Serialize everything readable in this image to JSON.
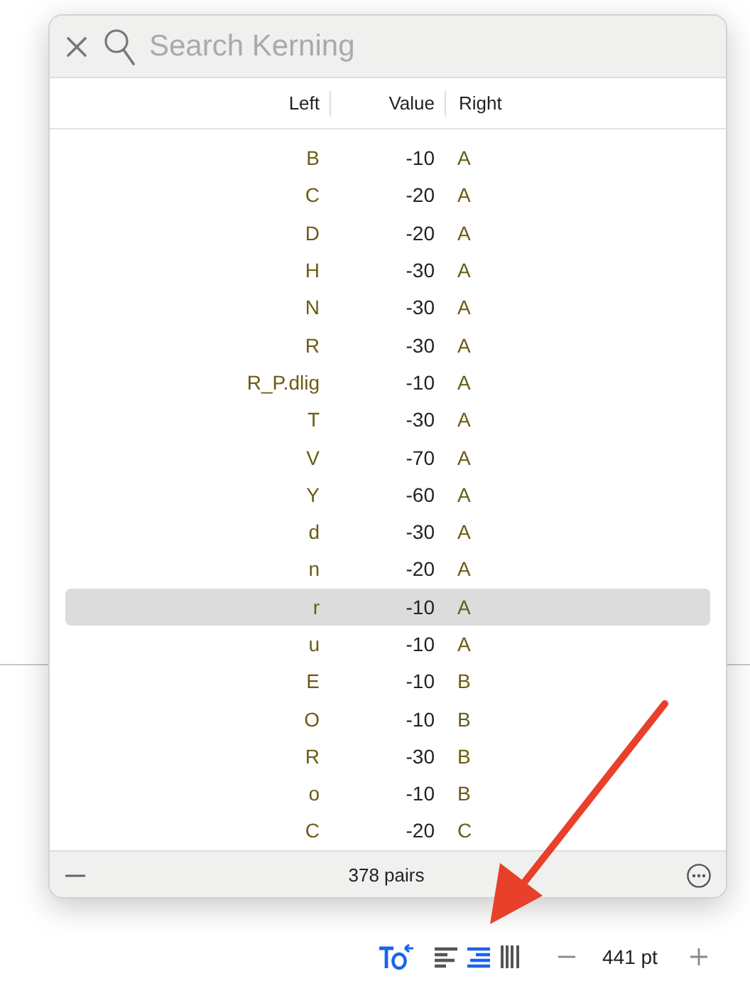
{
  "kerning_popover": {
    "search": {
      "placeholder": "Search Kerning"
    },
    "columns": [
      "Left",
      "Value",
      "Right"
    ],
    "rows": [
      {
        "left": "B",
        "value": "-10",
        "right": "A",
        "selected": false
      },
      {
        "left": "C",
        "value": "-20",
        "right": "A",
        "selected": false
      },
      {
        "left": "D",
        "value": "-20",
        "right": "A",
        "selected": false
      },
      {
        "left": "H",
        "value": "-30",
        "right": "A",
        "selected": false
      },
      {
        "left": "N",
        "value": "-30",
        "right": "A",
        "selected": false
      },
      {
        "left": "R",
        "value": "-30",
        "right": "A",
        "selected": false
      },
      {
        "left": "R_P.dlig",
        "value": "-10",
        "right": "A",
        "selected": false
      },
      {
        "left": "T",
        "value": "-30",
        "right": "A",
        "selected": false
      },
      {
        "left": "V",
        "value": "-70",
        "right": "A",
        "selected": false
      },
      {
        "left": "Y",
        "value": "-60",
        "right": "A",
        "selected": false
      },
      {
        "left": "d",
        "value": "-30",
        "right": "A",
        "selected": false
      },
      {
        "left": "n",
        "value": "-20",
        "right": "A",
        "selected": false
      },
      {
        "left": "r",
        "value": "-10",
        "right": "A",
        "selected": true
      },
      {
        "left": "u",
        "value": "-10",
        "right": "A",
        "selected": false
      },
      {
        "left": "E",
        "value": "-10",
        "right": "B",
        "selected": false
      },
      {
        "left": "O",
        "value": "-10",
        "right": "B",
        "selected": false
      },
      {
        "left": "R",
        "value": "-30",
        "right": "B",
        "selected": false
      },
      {
        "left": "o",
        "value": "-10",
        "right": "B",
        "selected": false
      },
      {
        "left": "C",
        "value": "-20",
        "right": "C",
        "selected": false
      }
    ],
    "footer": {
      "count": "378 pairs"
    }
  },
  "toolbar": {
    "tools": [
      {
        "kind": "text-kerning",
        "selected": true
      },
      {
        "kind": "align-left",
        "selected": false
      },
      {
        "kind": "align-right",
        "selected": true
      },
      {
        "kind": "columns",
        "selected": false
      }
    ],
    "size": "441 pt"
  }
}
